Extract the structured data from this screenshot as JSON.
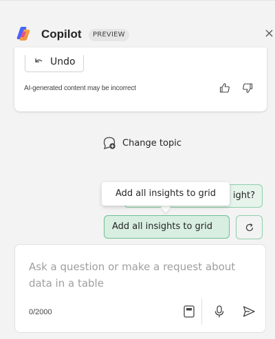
{
  "header": {
    "title": "Copilot",
    "badge": "PREVIEW",
    "close_glyph": "×"
  },
  "response_card": {
    "undo_label": "Undo",
    "disclaimer": "AI-generated content may be incorrect",
    "feedback_icons": [
      "thumbs-up-icon",
      "thumbs-down-icon"
    ]
  },
  "change_topic": {
    "label": "Change topic",
    "icon": "chat-add-icon"
  },
  "suggestions": {
    "chip_1_visible_text": "ight?",
    "chip_2_label": "Add all insights to grid",
    "refresh_icon": "refresh-icon"
  },
  "tooltip": {
    "text": "Add all insights to grid"
  },
  "composer": {
    "placeholder": "Ask a question or make a request about data in a table",
    "char_count": "0/2000",
    "icons": [
      "prompt-guide-icon",
      "microphone-icon",
      "send-icon"
    ]
  },
  "colors": {
    "background": "#f3f3f3",
    "chip_border": "#8ccfa9",
    "chip_fill": "#e6f4ec"
  }
}
